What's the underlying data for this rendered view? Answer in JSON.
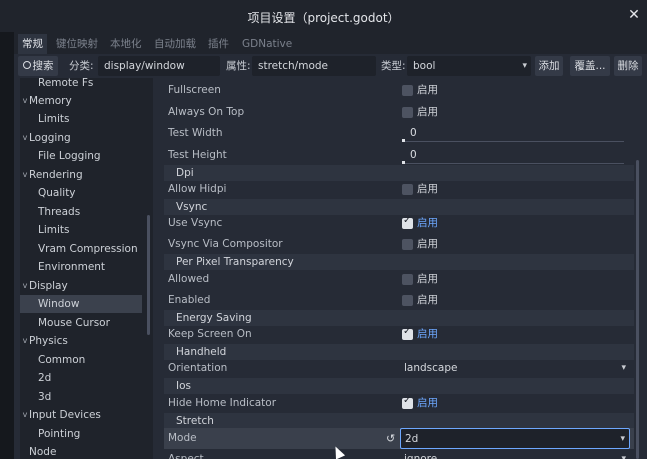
{
  "window": {
    "title": "项目设置（project.godot）",
    "close_icon": "✕"
  },
  "tabs": [
    {
      "label": "常规",
      "active": true
    },
    {
      "label": "键位映射",
      "active": false
    },
    {
      "label": "本地化",
      "active": false
    },
    {
      "label": "自动加载",
      "active": false
    },
    {
      "label": "插件",
      "active": false
    },
    {
      "label": "GDNative",
      "active": false
    }
  ],
  "filter": {
    "search_label": "搜索",
    "category_label": "分类:",
    "category_value": "display/window",
    "property_label": "属性:",
    "property_value": "stretch/mode",
    "type_label": "类型:",
    "type_value": "bool",
    "add_label": "添加",
    "override_label": "覆盖...",
    "delete_label": "删除"
  },
  "tree": [
    {
      "label": "Remote Fs",
      "level": 1
    },
    {
      "label": "Memory",
      "level": 0
    },
    {
      "label": "Limits",
      "level": 1
    },
    {
      "label": "Logging",
      "level": 0
    },
    {
      "label": "File Logging",
      "level": 1
    },
    {
      "label": "Rendering",
      "level": 0
    },
    {
      "label": "Quality",
      "level": 1
    },
    {
      "label": "Threads",
      "level": 1
    },
    {
      "label": "Limits",
      "level": 1
    },
    {
      "label": "Vram Compression",
      "level": 1
    },
    {
      "label": "Environment",
      "level": 1
    },
    {
      "label": "Display",
      "level": 0
    },
    {
      "label": "Window",
      "level": 1,
      "selected": true
    },
    {
      "label": "Mouse Cursor",
      "level": 1
    },
    {
      "label": "Physics",
      "level": 0
    },
    {
      "label": "Common",
      "level": 1
    },
    {
      "label": "2d",
      "level": 1
    },
    {
      "label": "3d",
      "level": 1
    },
    {
      "label": "Input Devices",
      "level": 0
    },
    {
      "label": "Pointing",
      "level": 1
    },
    {
      "label": "Node",
      "level": 0
    }
  ],
  "enable_label": "启用",
  "props": {
    "fullscreen": "Fullscreen",
    "always_on_top": "Always On Top",
    "test_width": "Test Width",
    "test_width_value": "0",
    "test_height": "Test Height",
    "test_height_value": "0",
    "sec_dpi": "Dpi",
    "allow_hidpi": "Allow Hidpi",
    "sec_vsync": "Vsync",
    "use_vsync": "Use Vsync",
    "vsync_compositor": "Vsync Via Compositor",
    "sec_ppt": "Per Pixel Transparency",
    "allowed": "Allowed",
    "enabled": "Enabled",
    "sec_energy": "Energy Saving",
    "keep_screen_on": "Keep Screen On",
    "sec_handheld": "Handheld",
    "orientation": "Orientation",
    "orientation_value": "landscape",
    "sec_ios": "Ios",
    "hide_home": "Hide Home Indicator",
    "sec_stretch": "Stretch",
    "mode": "Mode",
    "mode_value": "2d",
    "aspect": "Aspect",
    "aspect_value": "ignore"
  },
  "colors": {
    "accent": "#6ea8ff",
    "panel": "#262b36",
    "tree_bg": "#1f232b"
  },
  "icons": {
    "search": "search-icon",
    "revert": "revert-icon",
    "chevron": "chevron-down-icon"
  }
}
